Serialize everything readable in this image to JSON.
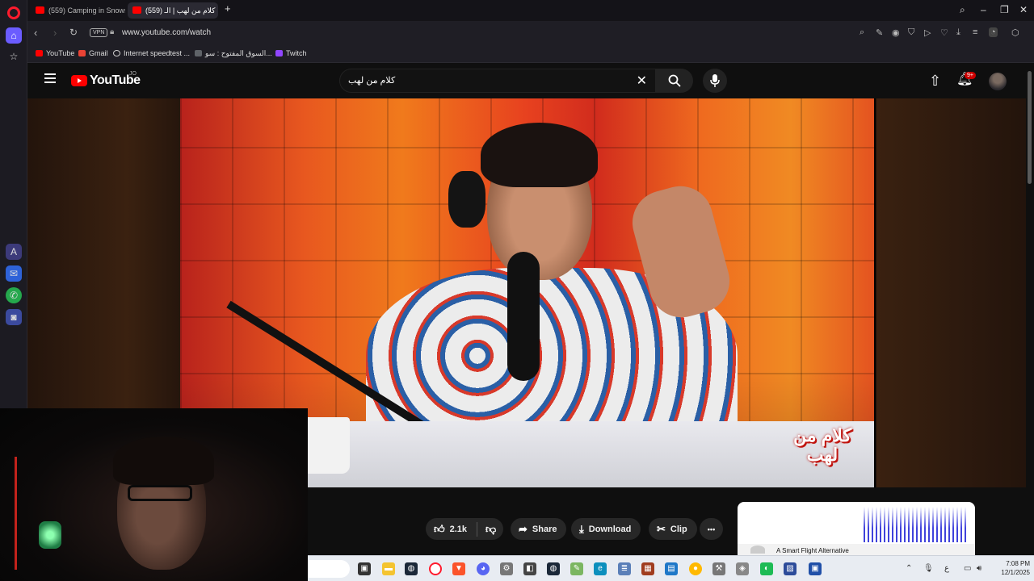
{
  "browser": {
    "tabs": [
      {
        "label": "(559) Camping in Snowst"
      },
      {
        "label": "(559) كلام من لهب | الـ"
      }
    ],
    "new_tab": "+",
    "url": "www.youtube.com/watch",
    "vpn_label": "VPN",
    "bookmarks": [
      {
        "label": "YouTube",
        "color": "#ff0000"
      },
      {
        "label": "Gmail",
        "color": "#ea4335"
      },
      {
        "label": "Internet speedtest ...",
        "color": "#9aa0a6"
      },
      {
        "label": "السوق المفتوح : سو...",
        "color": "#5f6368"
      },
      {
        "label": "Twitch",
        "color": "#9146ff"
      }
    ]
  },
  "youtube": {
    "logo_text": "YouTube",
    "country_code": "JO",
    "search_query": "كلام من لهب",
    "notification_badge": "9+",
    "video_brand_line1": "كلام من",
    "video_brand_line2": "لهب"
  },
  "actions": {
    "like_count": "2.1k",
    "share_label": "Share",
    "download_label": "Download",
    "clip_label": "Clip",
    "more_label": "•••"
  },
  "ad": {
    "title": "A Smart Flight Alternative"
  },
  "taskbar": {
    "time": "7:08 PM",
    "date": "12/1/2025",
    "lang": "ع"
  },
  "colors": {
    "accent": "#6b5cff",
    "yt_red": "#ff0000",
    "opera_red": "#ff1b2d"
  }
}
